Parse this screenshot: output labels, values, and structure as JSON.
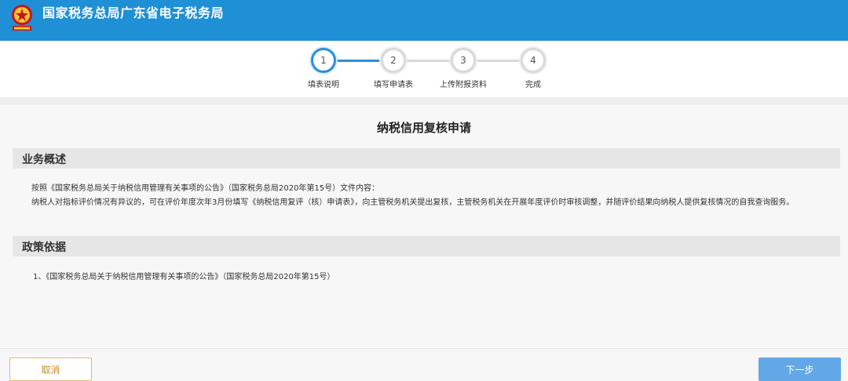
{
  "header": {
    "title": "国家税务总局广东省电子税务局",
    "logo_icon": "tax-emblem-icon",
    "background": "#1f8fd6"
  },
  "steps": [
    {
      "number": "1",
      "label": "填表说明",
      "active": true
    },
    {
      "number": "2",
      "label": "填写申请表",
      "active": false
    },
    {
      "number": "3",
      "label": "上传附报资料",
      "active": false
    },
    {
      "number": "4",
      "label": "完成",
      "active": false
    }
  ],
  "main": {
    "title": "纳税信用复核申请",
    "overview": {
      "heading": "业务概述",
      "line1": "按照《国家税务总局关于纳税信用管理有关事项的公告》（国家税务总局2020年第15号）文件内容：",
      "line2": "纳税人对指标评价情况有异议的，可在评价年度次年3月份填写《纳税信用复评（核）申请表》，向主管税务机关提出复核，主管税务机关在开展年度评价时审核调整，并随评价结果向纳税人提供复核情况的自我查询服务。"
    },
    "policy": {
      "heading": "政策依据",
      "item1": "1、《国家税务总局关于纳税信用管理有关事项的公告》（国家税务总局2020年第15号）"
    }
  },
  "footer": {
    "cancel_label": "取消",
    "next_label": "下一步"
  }
}
